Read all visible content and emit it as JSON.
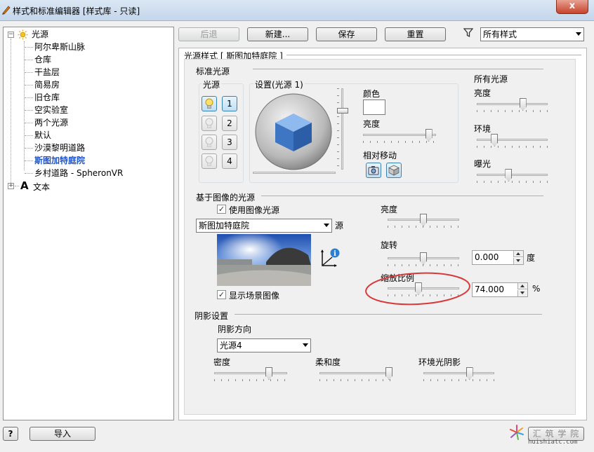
{
  "window": {
    "title": "样式和标准编辑器 [样式库 - 只读]",
    "close_glyph": "x"
  },
  "tree": {
    "root_label": "光源",
    "root_icon": "sun-icon",
    "items": [
      "阿尔卑斯山脉",
      "仓库",
      "干盐层",
      "简易房",
      "旧仓库",
      "空实验室",
      "两个光源",
      "默认",
      "沙漠黎明道路",
      "斯图加特庭院",
      "乡村道路 - SpheronVR"
    ],
    "selected_item": "斯图加特庭院",
    "text_root_label": "文本",
    "text_root_glyph": "A"
  },
  "toolbar": {
    "back": "后退",
    "new": "新建...",
    "save": "保存",
    "reset": "重置",
    "filter_icon": "filter-icon",
    "filter_value": "所有样式"
  },
  "style_panel": {
    "header": "光源样式 [ 斯图加特庭院 ]",
    "standard_lights": {
      "title": "标准光源",
      "lights_group": "光源",
      "light_numbers": [
        "1",
        "2",
        "3",
        "4"
      ],
      "settings_group": "设置(光源 1)",
      "color_label": "颜色",
      "brightness_label": "亮度",
      "brightness_value": 0.9,
      "relative_move_label": "相对移动"
    },
    "all_lights": {
      "title": "所有光源",
      "brightness": "亮度",
      "brightness_value": 0.65,
      "ambient": "环境",
      "ambient_value": 0.25,
      "exposure": "曝光",
      "exposure_value": 0.45
    },
    "image_based": {
      "title": "基于图像的光源",
      "use_image_light": "使用图像光源",
      "source_value": "斯图加特庭院",
      "source_label": "源",
      "show_scene_image": "显示场景图像",
      "brightness": "亮度",
      "brightness_value": 0.5,
      "rotation": "旋转",
      "rotation_value": 0.5,
      "rotation_input": "0.000",
      "rotation_unit": "度",
      "scale": "缩放比例",
      "scale_value": 0.43,
      "scale_input": "74.000",
      "scale_unit": "%"
    },
    "shadow": {
      "title": "阴影设置",
      "direction_label": "阴影方向",
      "direction_value": "光源4",
      "density": "密度",
      "density_value": 0.75,
      "softness": "柔和度",
      "softness_value": 0.98,
      "ambient_occlusion": "环境光阴影",
      "ambient_occlusion_value": 0.65
    }
  },
  "footer": {
    "help_glyph": "?",
    "import": "导入",
    "watermark_main": "汇 筑 学 院",
    "watermark_url": "huishiatc.com"
  },
  "colors": {
    "annotation_circle": "#d9383a",
    "cube": "#4a86d0",
    "selected_text": "#1e54c8",
    "info_icon": "#2a7fd4"
  }
}
